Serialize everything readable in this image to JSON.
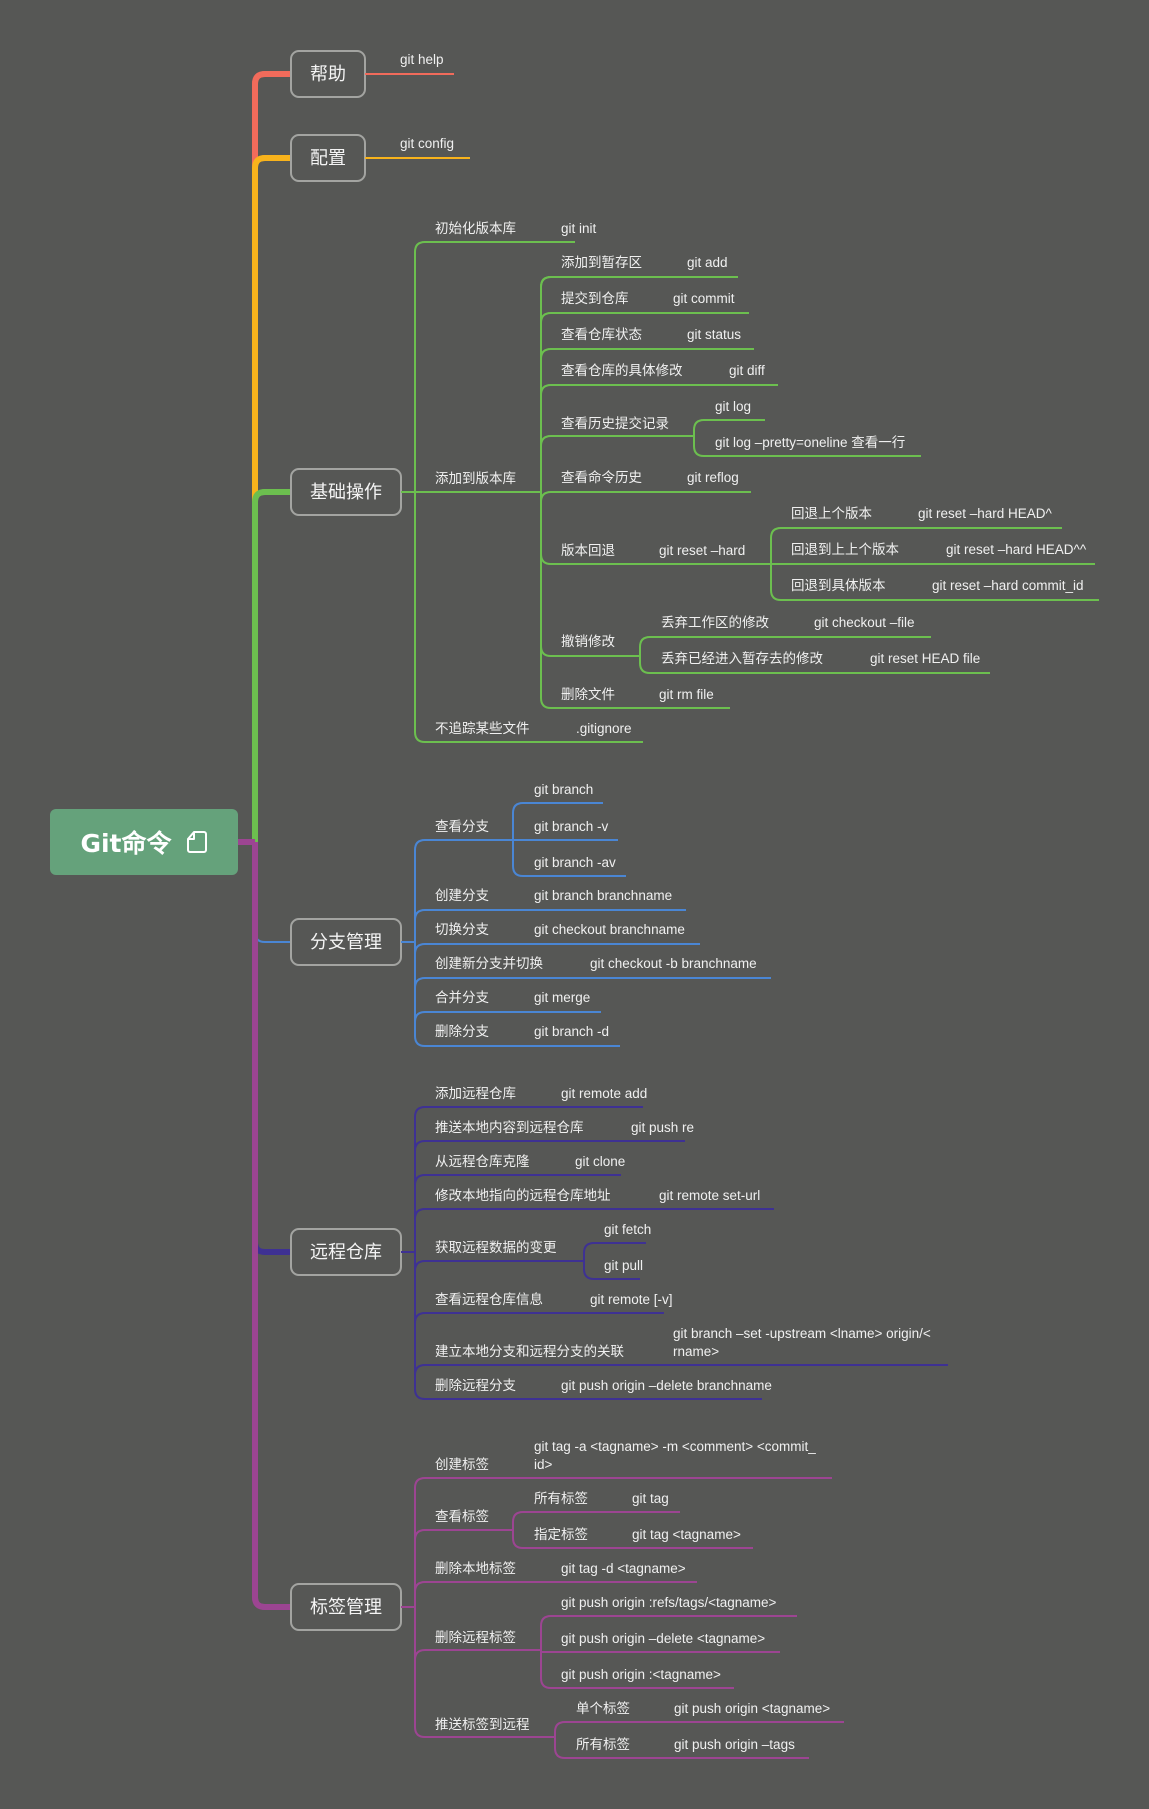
{
  "root": {
    "title": "Git命令",
    "icon": "note-icon",
    "color": "#65a27b"
  },
  "branches": [
    {
      "label": "帮助",
      "color": "#f16b5b",
      "children": [
        {
          "text": "git help"
        }
      ]
    },
    {
      "label": "配置",
      "color": "#f8b31c",
      "children": [
        {
          "text": "git  config"
        }
      ]
    },
    {
      "label": "基础操作",
      "color": "#6cbf4f",
      "children": [
        {
          "text": "初始化版本库",
          "cmd": "git init"
        },
        {
          "text": "添加到版本库",
          "children": [
            {
              "text": "添加到暂存区",
              "cmd": "git add"
            },
            {
              "text": "提交到仓库",
              "cmd": "git commit"
            },
            {
              "text": "查看仓库状态",
              "cmd": "git status"
            },
            {
              "text": "查看仓库的具体修改",
              "cmd": "git diff"
            },
            {
              "text": "查看历史提交记录",
              "children": [
                {
                  "text": "git log"
                },
                {
                  "text": "git log –pretty=oneline 查看一行"
                }
              ]
            },
            {
              "text": "查看命令历史",
              "cmd": "git reflog"
            },
            {
              "text": "版本回退",
              "cmd": "git reset –hard",
              "children": [
                {
                  "text": "回退上个版本",
                  "cmd": "git reset –hard HEAD^"
                },
                {
                  "text": "回退到上上个版本",
                  "cmd": "git reset –hard HEAD^^"
                },
                {
                  "text": "回退到具体版本",
                  "cmd": "git reset –hard commit_id"
                }
              ]
            },
            {
              "text": "撤销修改",
              "children": [
                {
                  "text": "丢弃工作区的修改",
                  "cmd": "git checkout –file"
                },
                {
                  "text": "丢弃已经进入暂存去的修改",
                  "cmd": "git reset HEAD file"
                }
              ]
            },
            {
              "text": "删除文件",
              "cmd": "git rm file"
            }
          ]
        },
        {
          "text": "不追踪某些文件",
          "cmd": ".gitignore"
        }
      ]
    },
    {
      "label": "分支管理",
      "color": "#4a86d4",
      "children": [
        {
          "text": "查看分支",
          "children": [
            {
              "text": "git branch"
            },
            {
              "text": "git branch -v"
            },
            {
              "text": "git branch -av"
            }
          ]
        },
        {
          "text": "创建分支",
          "cmd": "git branch branchname"
        },
        {
          "text": "切换分支",
          "cmd": "git checkout branchname"
        },
        {
          "text": "创建新分支并切换",
          "cmd": "git checkout -b branchname"
        },
        {
          "text": "合并分支",
          "cmd": "git merge"
        },
        {
          "text": "删除分支",
          "cmd": "git branch -d"
        }
      ]
    },
    {
      "label": "远程仓库",
      "color": "#3e3193",
      "children": [
        {
          "text": "添加远程仓库",
          "cmd": "git remote add"
        },
        {
          "text": "推送本地内容到远程仓库",
          "cmd": "git push re"
        },
        {
          "text": "从远程仓库克隆",
          "cmd": "git clone"
        },
        {
          "text": "修改本地指向的远程仓库地址",
          "cmd": "git remote set-url"
        },
        {
          "text": "获取远程数据的变更",
          "children": [
            {
              "text": "git fetch"
            },
            {
              "text": "git pull"
            }
          ]
        },
        {
          "text": "查看远程仓库信息",
          "cmd": "git remote [-v]"
        },
        {
          "text": "建立本地分支和远程分支的关联",
          "cmd": "git branch –set -upstream <lname> origin/<\nrname>"
        },
        {
          "text": "删除远程分支",
          "cmd": "git push origin –delete branchname"
        }
      ]
    },
    {
      "label": "标签管理",
      "color": "#9c4592",
      "children": [
        {
          "text": "创建标签",
          "cmd": "git tag -a <tagname> -m <comment> <commit_\nid>"
        },
        {
          "text": "查看标签",
          "children": [
            {
              "text": "所有标签",
              "cmd": "git tag"
            },
            {
              "text": "指定标签",
              "cmd": "git tag <tagname>"
            }
          ]
        },
        {
          "text": "删除本地标签",
          "cmd": "git tag -d <tagname>"
        },
        {
          "text": "删除远程标签",
          "children": [
            {
              "text": "git push origin :refs/tags/<tagname>"
            },
            {
              "text": "git push origin –delete <tagname>"
            },
            {
              "text": "git push origin :<tagname>"
            }
          ]
        },
        {
          "text": "推送标签到远程",
          "children": [
            {
              "text": "单个标签",
              "cmd": "git push origin <tagname>"
            },
            {
              "text": "所有标签",
              "cmd": "git push origin –tags"
            }
          ]
        }
      ]
    }
  ]
}
